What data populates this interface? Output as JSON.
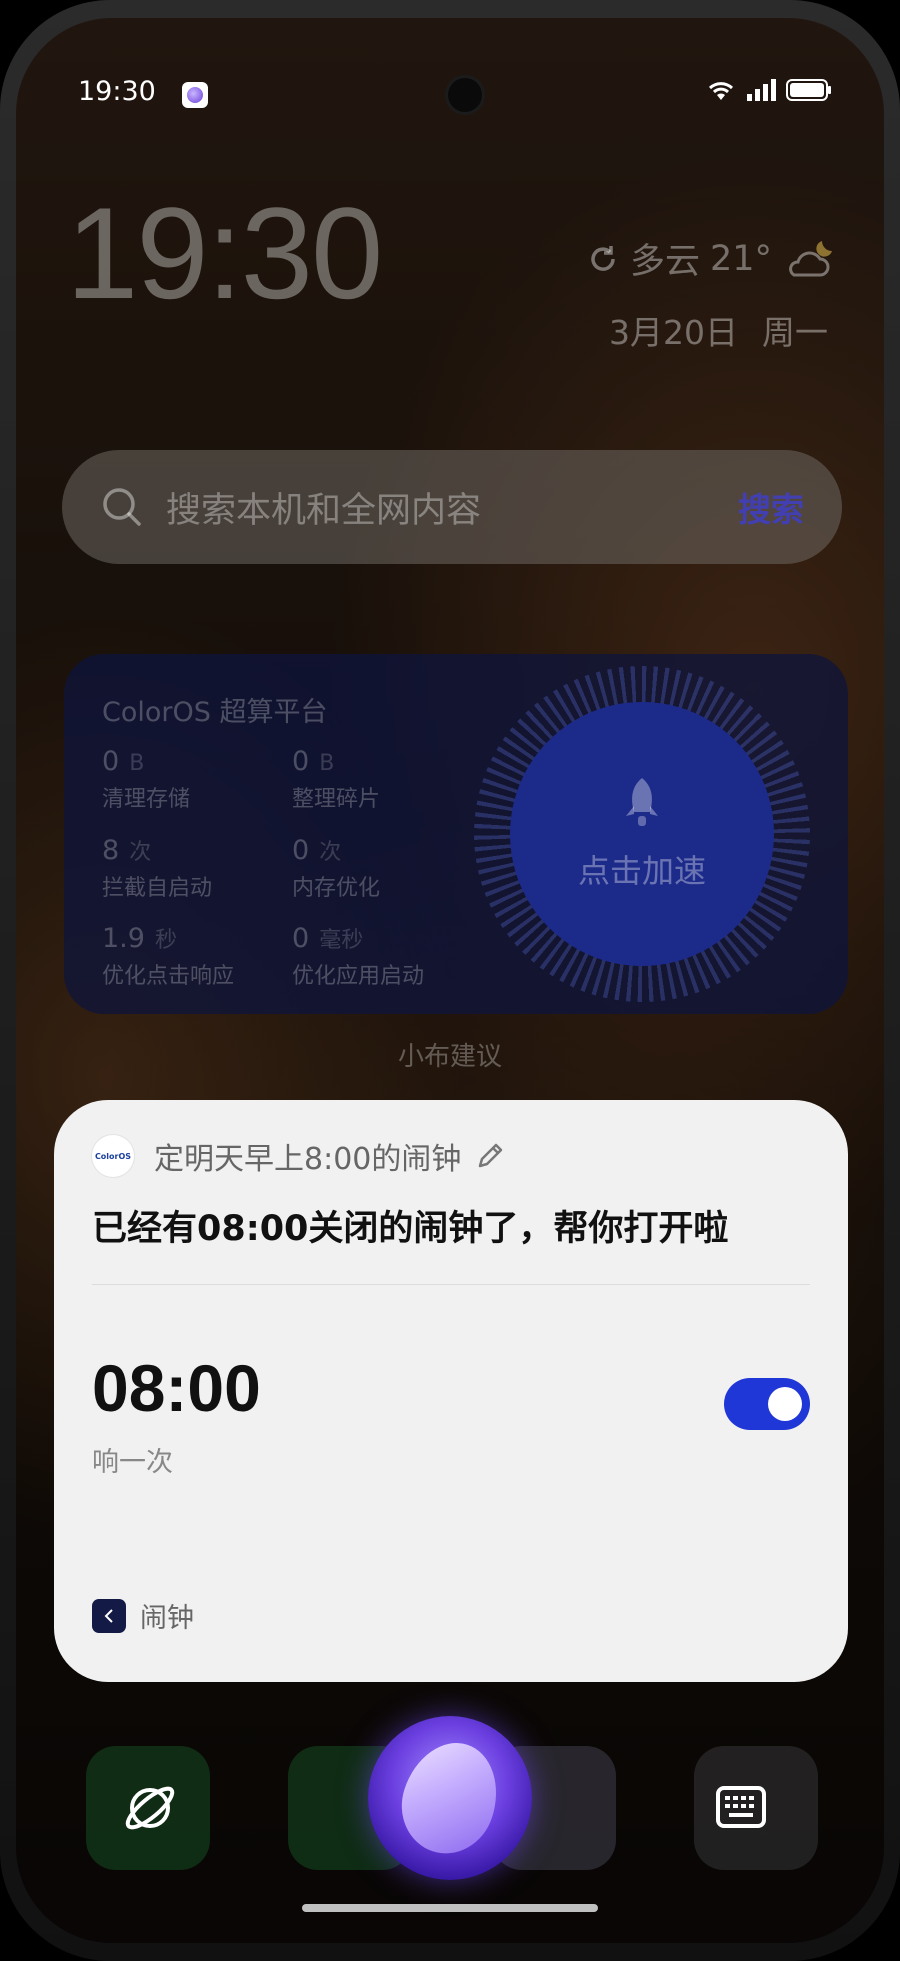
{
  "status_bar": {
    "time": "19:30"
  },
  "lock_widget": {
    "clock": "19:30",
    "weather": {
      "condition": "多云",
      "temperature": "21°"
    },
    "date": "3月20日",
    "weekday": "周一"
  },
  "search": {
    "placeholder": "搜索本机和全网内容",
    "button": "搜索"
  },
  "perf_widget": {
    "title": "ColorOS 超算平台",
    "stats": [
      {
        "value": "0",
        "unit": "B",
        "label": "清理存储"
      },
      {
        "value": "0",
        "unit": "B",
        "label": "整理碎片"
      },
      {
        "value": "8",
        "unit": "次",
        "label": "拦截自启动"
      },
      {
        "value": "0",
        "unit": "次",
        "label": "内存优化"
      },
      {
        "value": "1.9",
        "unit": "秒",
        "label": "优化点击响应"
      },
      {
        "value": "0",
        "unit": "毫秒",
        "label": "优化应用启动"
      }
    ],
    "boost_label": "点击加速"
  },
  "suggestion_label": "小布建议",
  "assistant_card": {
    "logo_text": "ColorOS",
    "query": "定明天早上8:00的闹钟",
    "reply": "已经有08:00关闭的闹钟了，帮你打开啦",
    "alarm": {
      "time": "08:00",
      "repeat": "响一次",
      "enabled": true
    },
    "source_app": "闹钟"
  },
  "colors": {
    "toggle_on": "#1e37d6",
    "card_bg": "#f1f1f1"
  }
}
